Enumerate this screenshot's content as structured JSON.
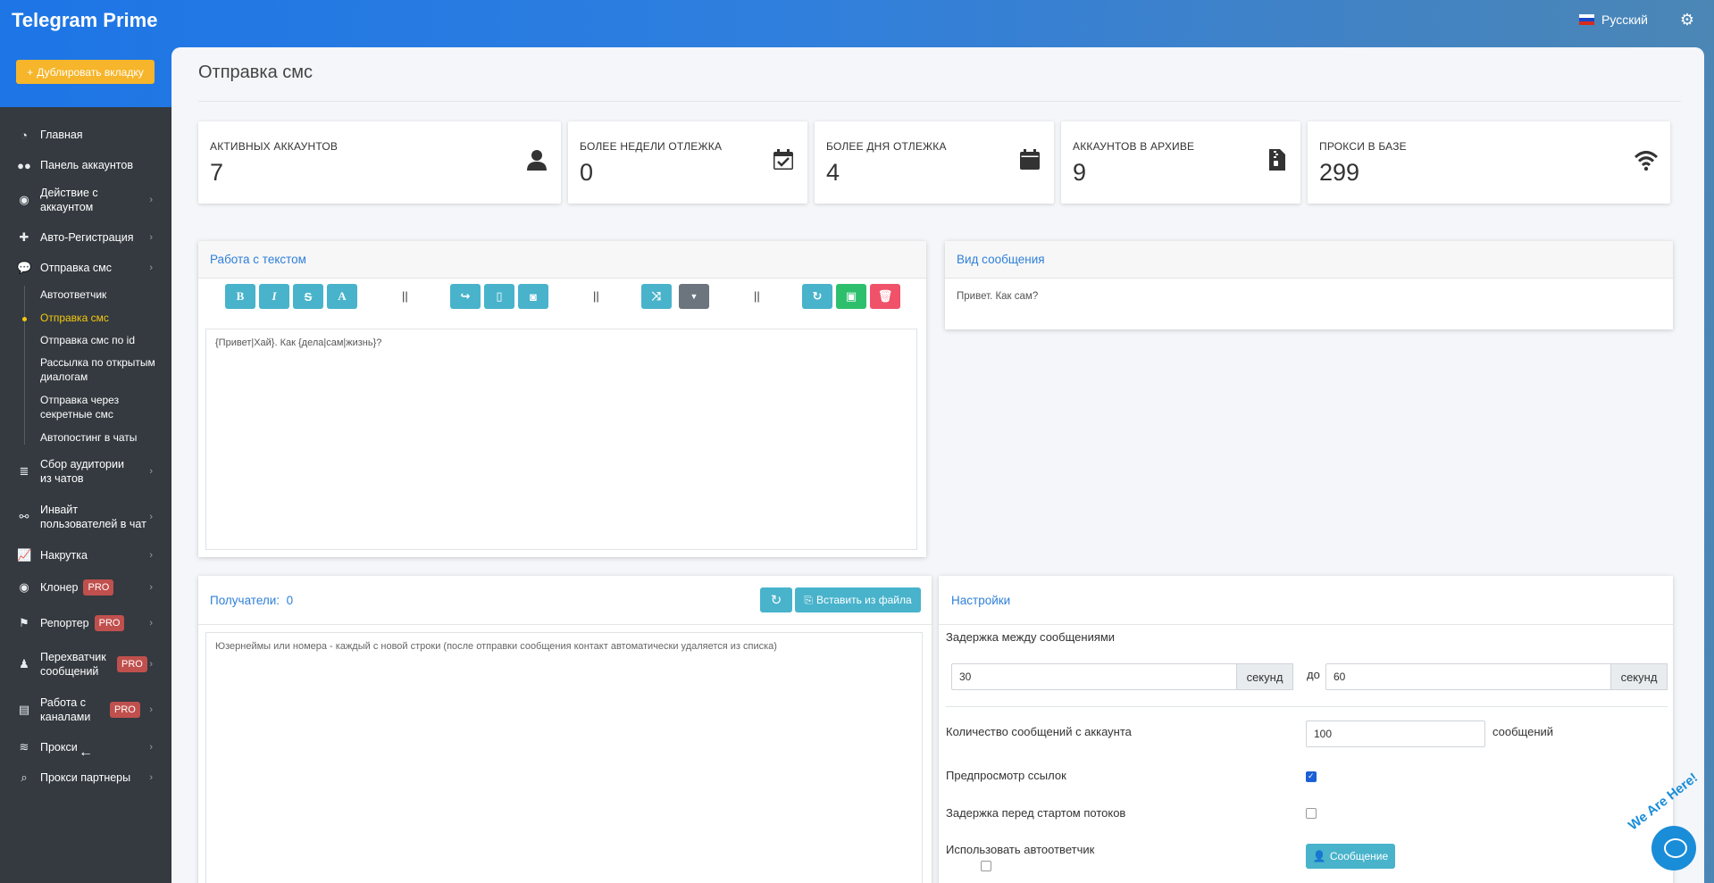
{
  "app": {
    "title": "Telegram Prime",
    "duplicate_label": "Дублировать вкладку",
    "language": "Русский"
  },
  "sidebar": {
    "items": [
      {
        "label": "Главная"
      },
      {
        "label": "Панель аккаунтов"
      },
      {
        "label": "Действие с аккаунтом"
      },
      {
        "label": "Авто-Регистрация"
      },
      {
        "label": "Отправка смс"
      },
      {
        "label": "Сбор аудитории из чатов"
      },
      {
        "label": "Инвайт пользователей в чат"
      },
      {
        "label": "Накрутка"
      },
      {
        "label": "Клонер",
        "badge": "PRO"
      },
      {
        "label": "Репортер",
        "badge": "PRO"
      },
      {
        "label": "Перехватчик сообщений",
        "badge": "PRO"
      },
      {
        "label": "Работа с каналами",
        "badge": "PRO"
      },
      {
        "label": "Прокси"
      },
      {
        "label": "Прокси партнеры"
      }
    ],
    "subitems": [
      {
        "label": "Автоответчик"
      },
      {
        "label": "Отправка смс"
      },
      {
        "label": "Отправка смс по id"
      },
      {
        "label": "Рассылка по открытым диалогам"
      },
      {
        "label": "Отправка через секретные смс"
      },
      {
        "label": "Автопостинг в чаты"
      }
    ]
  },
  "page": {
    "title": "Отправка смс"
  },
  "stats": [
    {
      "label": "АКТИВНЫХ АККАУНТОВ",
      "value": "7"
    },
    {
      "label": "БОЛЕЕ НЕДЕЛИ ОТЛЕЖКА",
      "value": "0"
    },
    {
      "label": "БОЛЕЕ ДНЯ ОТЛЕЖКА",
      "value": "4"
    },
    {
      "label": "АККАУНТОВ В АРХИВЕ",
      "value": "9"
    },
    {
      "label": "ПРОКСИ В БАЗЕ",
      "value": "299"
    }
  ],
  "editor": {
    "title": "Работа с текстом",
    "toolbar": {
      "bold": "B",
      "italic": "I",
      "strike": "S",
      "font": "A",
      "separator": "||"
    },
    "text": "{Привет|Хай}. Как {дела|сам|жизнь}?"
  },
  "preview": {
    "title": "Вид сообщения",
    "text": "Привет. Как сам?"
  },
  "recipients": {
    "title": "Получатели:",
    "count": "0",
    "import_label": "Вставить из файла",
    "placeholder": "Юзернеймы или номера - каждый с новой строки (после отправки сообщения контакт автоматически удаляется из списка)"
  },
  "settings": {
    "title": "Настройки",
    "delay_label": "Задержка между сообщениями",
    "delay_from": "30",
    "delay_to": "60",
    "seconds_unit": "секунд",
    "to_word": "до",
    "count_label": "Количество сообщений с аккаунта",
    "count_value": "100",
    "count_unit": "сообщений",
    "link_preview_label": "Предпросмотр ссылок",
    "link_preview_checked": true,
    "thread_delay_label": "Задержка перед стартом потоков",
    "thread_delay_checked": false,
    "autoresponder_label": "Использовать автоответчик",
    "autoresponder_checked": false,
    "message_button": "Сообщение"
  },
  "chat": {
    "tag": "We Are Here!"
  },
  "colors": {
    "accent": "#2f7fd8",
    "info": "#48b3cb",
    "success": "#2ebf6d",
    "danger": "#f0526a",
    "warning": "#f6b52a",
    "sidebar": "#343a40",
    "active_sub": "#f6c90e"
  }
}
